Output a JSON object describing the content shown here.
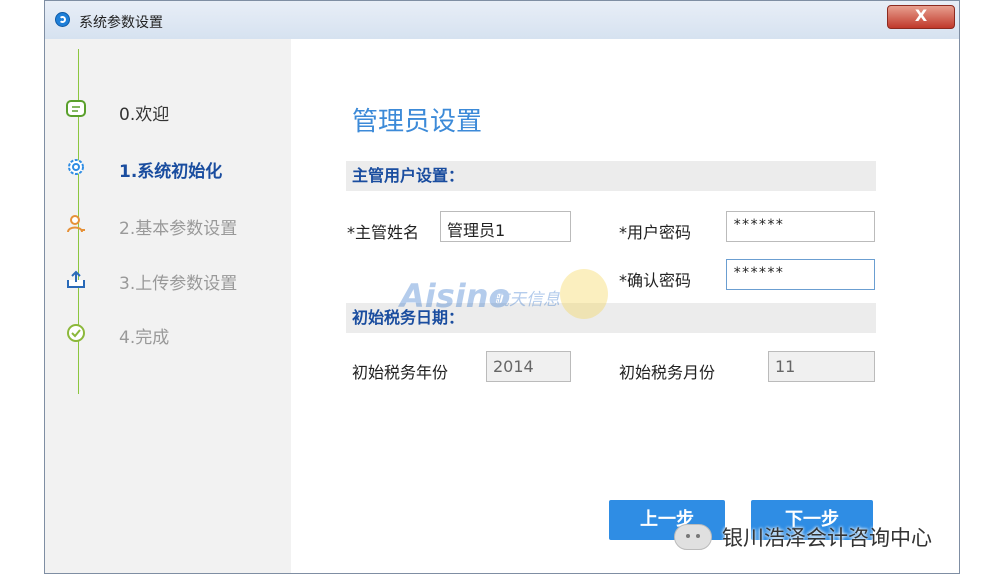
{
  "window": {
    "title": "系统参数设置",
    "close_label": "X"
  },
  "sidebar": {
    "steps": [
      {
        "label": "0.欢迎",
        "state": "done",
        "icon": "chat-icon"
      },
      {
        "label": "1.系统初始化",
        "state": "active",
        "icon": "gear-icon"
      },
      {
        "label": "2.基本参数设置",
        "state": "todo",
        "icon": "user-icon"
      },
      {
        "label": "3.上传参数设置",
        "state": "todo",
        "icon": "upload-icon"
      },
      {
        "label": "4.完成",
        "state": "todo",
        "icon": "check-circle-icon"
      }
    ]
  },
  "content": {
    "heading": "管理员设置",
    "main_user_section": "主管用户设置：",
    "admin_name_label": "*主管姓名",
    "admin_name_value": "管理员1",
    "password_label": "*用户密码",
    "password_value": "******",
    "confirm_label": "*确认密码",
    "confirm_value": "******",
    "tax_date_section": "初始税务日期：",
    "tax_year_label": "初始税务年份",
    "tax_year_value": "2014",
    "tax_month_label": "初始税务月份",
    "tax_month_value": "11",
    "prev_button": "上一步",
    "next_button": "下一步"
  },
  "watermark": {
    "brand": "Aisino",
    "brand_cn": "航天信息"
  },
  "wechat_caption": "银川浩泽会计咨询中心",
  "colors": {
    "accent": "#2f8de4",
    "step_line": "#8cc63f",
    "active_step": "#1a4d9f"
  }
}
